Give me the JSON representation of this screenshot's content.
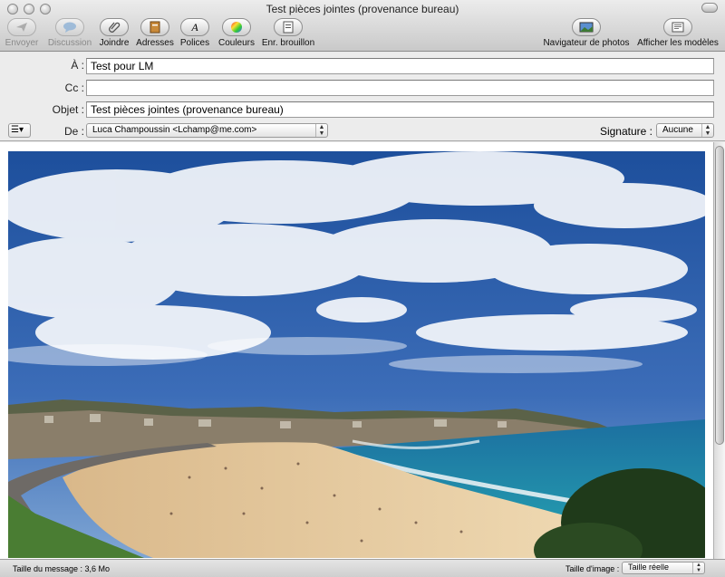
{
  "window": {
    "title": "Test pièces jointes (provenance bureau)"
  },
  "toolbar": {
    "send": "Envoyer",
    "chat": "Discussion",
    "attach": "Joindre",
    "address": "Adresses",
    "fonts": "Polices",
    "colors": "Couleurs",
    "save_draft": "Enr. brouillon",
    "photo_browser": "Navigateur de photos",
    "show_templates": "Afficher les modèles"
  },
  "fields": {
    "to_label": "À :",
    "to_value": "Test pour LM",
    "cc_label": "Cc :",
    "cc_value": "",
    "subject_label": "Objet :",
    "subject_value": "Test pièces jointes (provenance bureau)",
    "from_label": "De :",
    "from_value": "Luca Champoussin <Lchamp@me.com>",
    "signature_label": "Signature :",
    "signature_value": "Aucune",
    "options_icon": "list-icon"
  },
  "status": {
    "size_text": "Taille du message : 3,6 Mo",
    "image_size_label": "Taille d'image :",
    "image_size_value": "Taille réelle"
  },
  "colors": {
    "sky": "#2c5ea8",
    "sea": "#1f8fa8",
    "sand": "#e3c79b"
  }
}
